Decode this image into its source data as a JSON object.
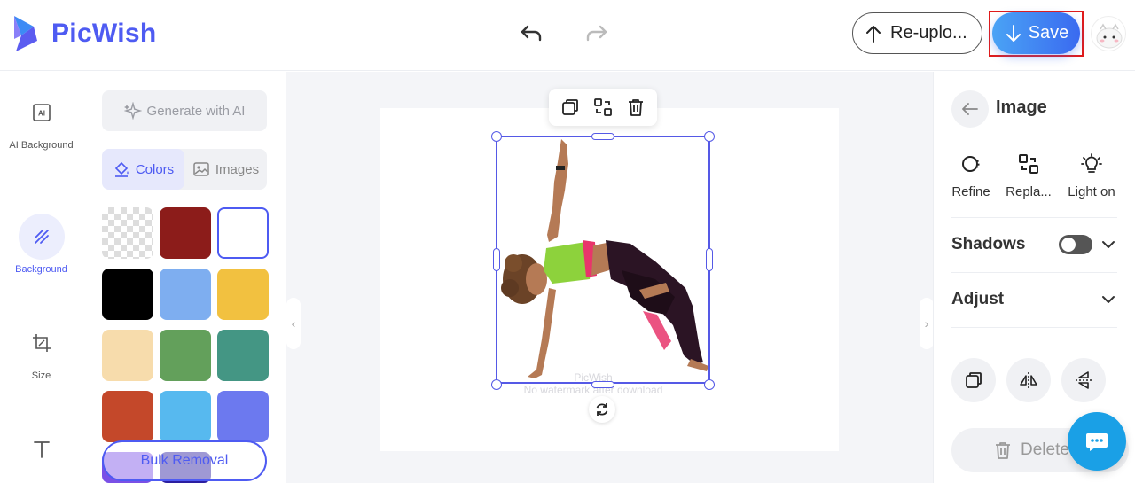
{
  "app": {
    "name": "PicWish"
  },
  "header": {
    "reupload_label": "Re-uplo...",
    "save_label": "Save"
  },
  "left_nav": [
    {
      "label": "AI Background",
      "icon": "ai-background-icon"
    },
    {
      "label": "Background",
      "icon": "background-icon",
      "active": true
    },
    {
      "label": "Size",
      "icon": "crop-icon"
    },
    {
      "label": "",
      "icon": "text-icon"
    }
  ],
  "panel": {
    "generate_label": "Generate with AI",
    "tabs": [
      {
        "label": "Colors",
        "active": true
      },
      {
        "label": "Images"
      }
    ],
    "colors": [
      "transparent",
      "#8c1c1a",
      "#ffffff",
      "#000000",
      "#7eaef0",
      "#f2c140",
      "#f7dcac",
      "#63a05b",
      "#449684",
      "#c4482a",
      "#57b9ef",
      "#6c79ef"
    ],
    "selected_color": "#ffffff",
    "bulk_label": "Bulk Removal"
  },
  "canvas": {
    "watermark_line1": "PicWish",
    "watermark_line2": "No watermark after download"
  },
  "right_panel": {
    "title": "Image",
    "tools": [
      {
        "label": "Refine"
      },
      {
        "label": "Repla..."
      },
      {
        "label": "Light on"
      }
    ],
    "shadows_label": "Shadows",
    "shadows_on": false,
    "adjust_label": "Adjust",
    "delete_label": "Delete"
  },
  "colors": {
    "brand": "#4e5bf2",
    "save_gradient": [
      "#4aa3f5",
      "#3a6af0"
    ],
    "highlight": "#e01b1b",
    "chat": "#1aa0e6"
  }
}
